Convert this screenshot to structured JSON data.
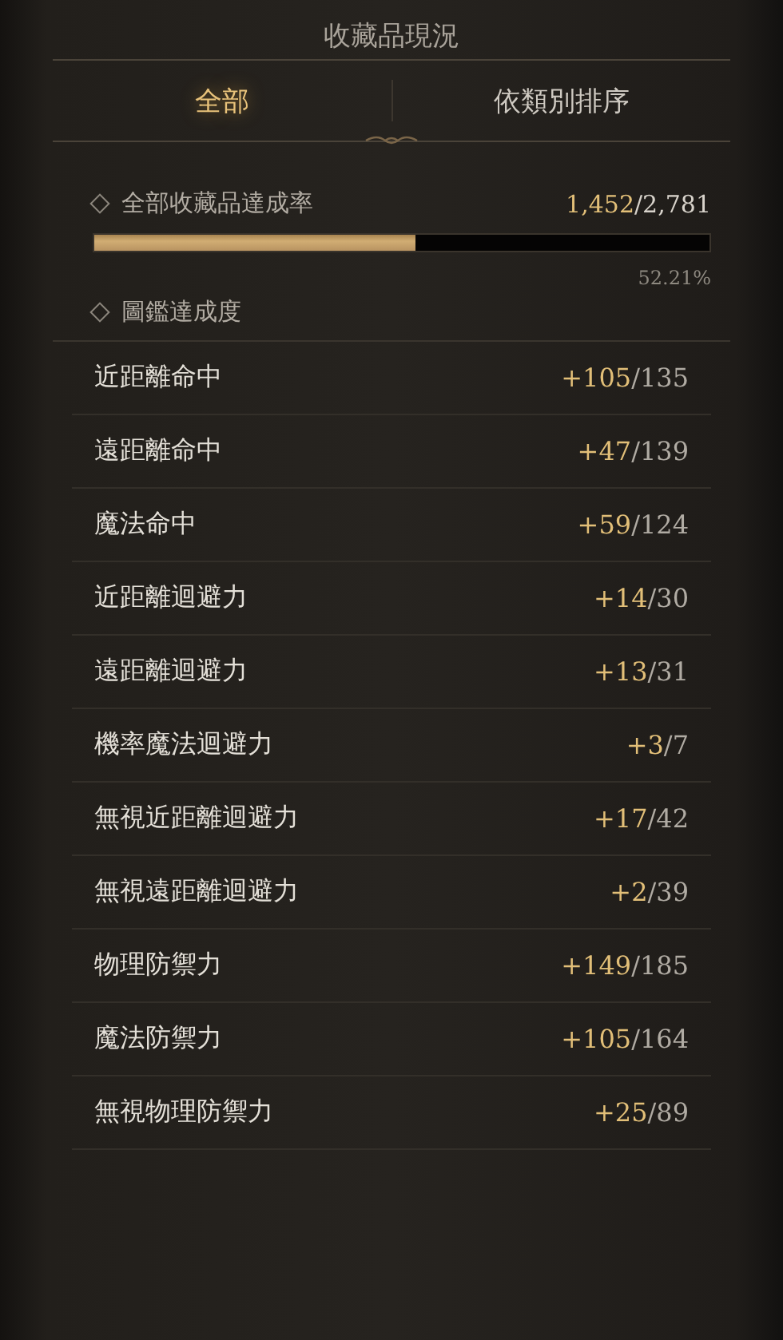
{
  "title": "收藏品現況",
  "tabs": [
    {
      "label": "全部",
      "selected": true
    },
    {
      "label": "依類別排序",
      "selected": false
    }
  ],
  "overall": {
    "label": "全部收藏品達成率",
    "current": "1,452",
    "total": "/2,781",
    "level": 0.522,
    "percent": "52.21%"
  },
  "section": {
    "label": "圖鑑達成度"
  },
  "stats": [
    {
      "name": "近距離命中",
      "bonus": "+105",
      "max": "/135"
    },
    {
      "name": "遠距離命中",
      "bonus": "+47",
      "max": "/139"
    },
    {
      "name": "魔法命中",
      "bonus": "+59",
      "max": "/124"
    },
    {
      "name": "近距離迴避力",
      "bonus": "+14",
      "max": "/30"
    },
    {
      "name": "遠距離迴避力",
      "bonus": "+13",
      "max": "/31"
    },
    {
      "name": "機率魔法迴避力",
      "bonus": "+3",
      "max": "/7"
    },
    {
      "name": "無視近距離迴避力",
      "bonus": "+17",
      "max": "/42"
    },
    {
      "name": "無視遠距離迴避力",
      "bonus": "+2",
      "max": "/39"
    },
    {
      "name": "物理防禦力",
      "bonus": "+149",
      "max": "/185"
    },
    {
      "name": "魔法防禦力",
      "bonus": "+105",
      "max": "/164"
    },
    {
      "name": "無視物理防禦力",
      "bonus": "+25",
      "max": "/89"
    }
  ]
}
